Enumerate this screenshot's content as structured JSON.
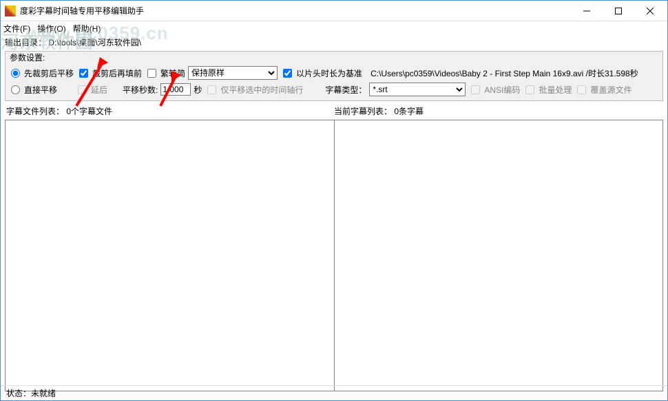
{
  "titlebar": {
    "title": "度彩字幕时间轴专用平移编辑助手"
  },
  "menu": {
    "file": "文件(F)",
    "operate": "操作(O)",
    "help": "帮助(H)"
  },
  "output_dir": {
    "label": "输出目录：",
    "path": "D:\\tools\\桌面\\河东软件园\\"
  },
  "watermark": "www.pc0359.cn",
  "watermark2": "河东软件园",
  "params": {
    "legend": "参数设置:",
    "radio_trim_then_shift": "先裁剪后平移",
    "chk_cut_then_fill": "裁剪后再填前",
    "chk_trad_simp": "繁转简",
    "select_keep": "保持原样",
    "chk_use_clip_duration": "以片头时长为基准",
    "file_info": "C:\\Users\\pc0359\\Videos\\Baby 2 - First Step Main 16x9.avi  /时长31.598秒",
    "radio_direct_shift": "直接平移",
    "chk_delay": "延后",
    "shift_seconds_label": "平移秒数:",
    "shift_seconds_value": "1.000",
    "seconds_unit": "秒",
    "chk_only_selected": "仅平移选中的时间轴行",
    "subtitle_type_label": "字幕类型：",
    "subtitle_type_value": "*.srt",
    "chk_ansi": "ANSI编码",
    "chk_batch": "批量处理",
    "chk_overwrite": "覆盖源文件"
  },
  "lists": {
    "left_label": "字幕文件列表：",
    "left_count": "0个字幕文件",
    "right_label": "当前字幕列表：",
    "right_count": "0条字幕"
  },
  "status": {
    "label": "状态：",
    "value": "未就绪"
  }
}
